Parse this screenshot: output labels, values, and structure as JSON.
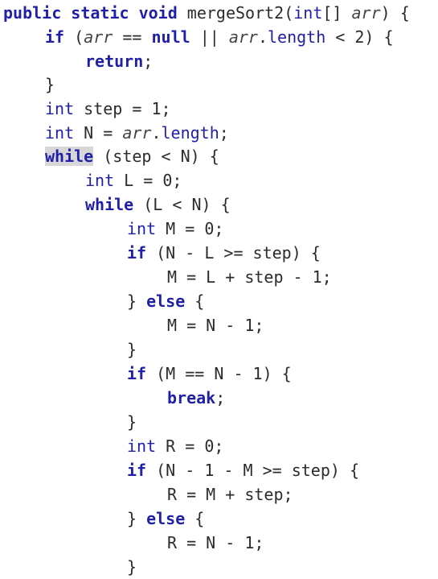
{
  "editor": {
    "background": "#ffffff",
    "keyword_color": "#1f1fa8",
    "text_color": "#2b2b2b",
    "lines": [
      [
        {
          "t": "public static void ",
          "c": "kw"
        },
        {
          "t": "mergeSort2(",
          "c": "id"
        },
        {
          "t": "int",
          "c": "ty"
        },
        {
          "t": "[] ",
          "c": "id"
        },
        {
          "t": "arr",
          "c": "it"
        },
        {
          "t": ") {",
          "c": "id"
        }
      ],
      [
        {
          "t": "if",
          "c": "kw"
        },
        {
          "t": " (",
          "c": "id"
        },
        {
          "t": "arr",
          "c": "it"
        },
        {
          "t": " == ",
          "c": "id"
        },
        {
          "t": "null",
          "c": "kw"
        },
        {
          "t": " || ",
          "c": "id"
        },
        {
          "t": "arr",
          "c": "it"
        },
        {
          "t": ".",
          "c": "id"
        },
        {
          "t": "length",
          "c": "fld"
        },
        {
          "t": " < 2) {",
          "c": "id"
        }
      ],
      [
        {
          "t": "return",
          "c": "kw"
        },
        {
          "t": ";",
          "c": "id"
        }
      ],
      [
        {
          "t": "}",
          "c": "id"
        }
      ],
      [
        {
          "t": "int",
          "c": "ty"
        },
        {
          "t": " step = 1;",
          "c": "id"
        }
      ],
      [
        {
          "t": "int",
          "c": "ty"
        },
        {
          "t": " N = ",
          "c": "id"
        },
        {
          "t": "arr",
          "c": "it"
        },
        {
          "t": ".",
          "c": "id"
        },
        {
          "t": "length",
          "c": "fld"
        },
        {
          "t": ";",
          "c": "id"
        }
      ],
      [
        {
          "t": "while",
          "c": "kw hl"
        },
        {
          "t": " (step < N) {",
          "c": "id"
        }
      ],
      [
        {
          "t": "int",
          "c": "ty"
        },
        {
          "t": " L = 0;",
          "c": "id"
        }
      ],
      [
        {
          "t": "while",
          "c": "kw"
        },
        {
          "t": " (L < N) {",
          "c": "id"
        }
      ],
      [
        {
          "t": "int",
          "c": "ty"
        },
        {
          "t": " M = 0;",
          "c": "id"
        }
      ],
      [
        {
          "t": "if",
          "c": "kw"
        },
        {
          "t": " (N - L >= step) {",
          "c": "id"
        }
      ],
      [
        {
          "t": "M = L + step - 1;",
          "c": "id"
        }
      ],
      [
        {
          "t": "} ",
          "c": "id"
        },
        {
          "t": "else",
          "c": "kw"
        },
        {
          "t": " {",
          "c": "id"
        }
      ],
      [
        {
          "t": "M = N - 1;",
          "c": "id"
        }
      ],
      [
        {
          "t": "}",
          "c": "id"
        }
      ],
      [
        {
          "t": "if",
          "c": "kw"
        },
        {
          "t": " (M == N - 1) {",
          "c": "id"
        }
      ],
      [
        {
          "t": "break",
          "c": "kw"
        },
        {
          "t": ";",
          "c": "id"
        }
      ],
      [
        {
          "t": "}",
          "c": "id"
        }
      ],
      [
        {
          "t": "int",
          "c": "ty"
        },
        {
          "t": " R = 0;",
          "c": "id"
        }
      ],
      [
        {
          "t": "if",
          "c": "kw"
        },
        {
          "t": " (N - 1 - M >= step) {",
          "c": "id"
        }
      ],
      [
        {
          "t": "R = M + step;",
          "c": "id"
        }
      ],
      [
        {
          "t": "} ",
          "c": "id"
        },
        {
          "t": "else",
          "c": "kw"
        },
        {
          "t": " {",
          "c": "id"
        }
      ],
      [
        {
          "t": "R = N - 1;",
          "c": "id"
        }
      ],
      [
        {
          "t": "}",
          "c": "id"
        }
      ]
    ]
  }
}
